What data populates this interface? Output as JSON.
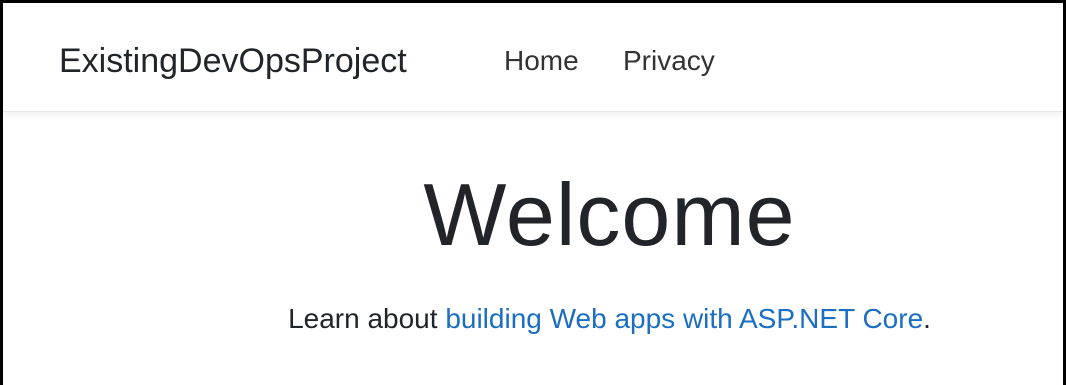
{
  "navbar": {
    "brand": "ExistingDevOpsProject",
    "links": [
      {
        "label": "Home"
      },
      {
        "label": "Privacy"
      }
    ]
  },
  "main": {
    "heading": "Welcome",
    "learn_prefix": "Learn about ",
    "learn_link": "building Web apps with ASP.NET Core",
    "learn_suffix": "."
  },
  "colors": {
    "link": "#1b6ec2",
    "text": "#212529"
  }
}
